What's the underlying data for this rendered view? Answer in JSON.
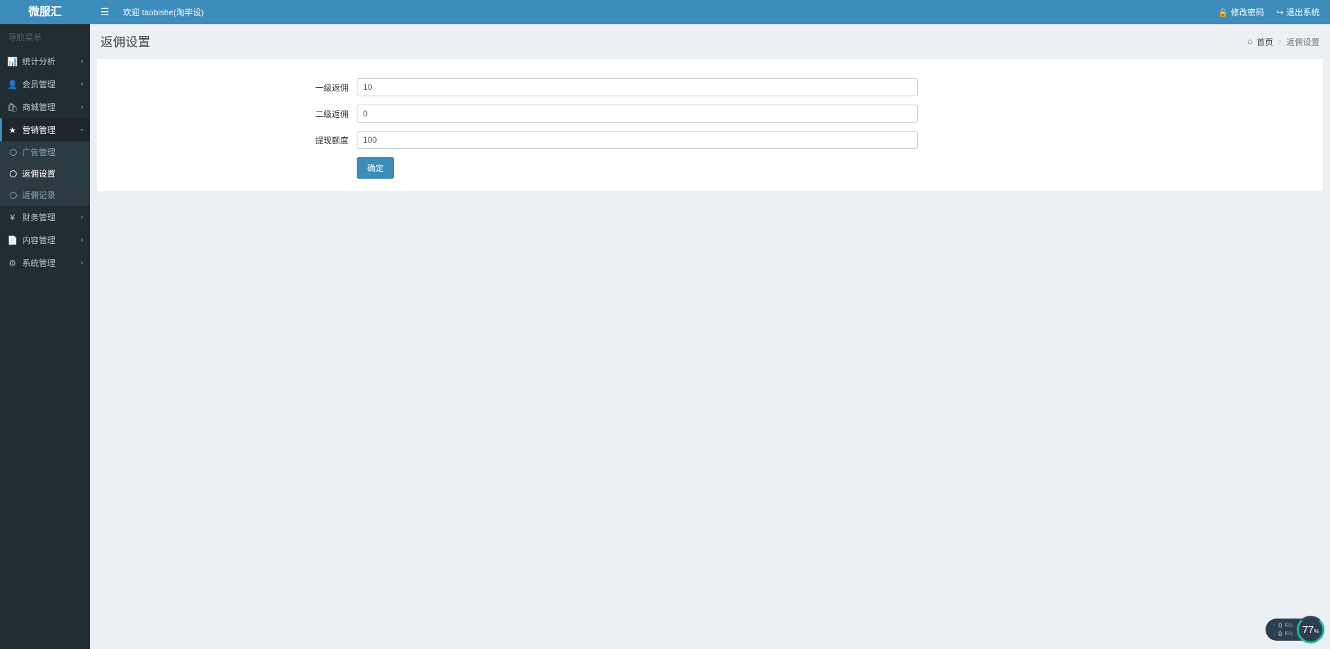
{
  "brand": "微服汇",
  "header": {
    "welcome": "欢迎 taobishe(淘毕设)",
    "change_password": "修改密码",
    "logout": "退出系统"
  },
  "sidebar": {
    "title": "导航菜单",
    "items": [
      {
        "icon": "📊",
        "label": "统计分析",
        "expanded": false
      },
      {
        "icon": "👤",
        "label": "会员管理",
        "expanded": false
      },
      {
        "icon": "🛍",
        "label": "商城管理",
        "expanded": false
      },
      {
        "icon": "★",
        "label": "营销管理",
        "expanded": true,
        "children": [
          {
            "label": "广告管理",
            "active": false
          },
          {
            "label": "返佣设置",
            "active": true
          },
          {
            "label": "返佣记录",
            "active": false
          }
        ]
      },
      {
        "icon": "¥",
        "label": "财务管理",
        "expanded": false
      },
      {
        "icon": "📄",
        "label": "内容管理",
        "expanded": false
      },
      {
        "icon": "⚙",
        "label": "系统管理",
        "expanded": false
      }
    ]
  },
  "page": {
    "title": "返佣设置",
    "breadcrumb": {
      "home": "首页",
      "current": "返佣设置"
    }
  },
  "form": {
    "level1": {
      "label": "一级返佣",
      "value": "10"
    },
    "level2": {
      "label": "二级返佣",
      "value": "0"
    },
    "withdraw": {
      "label": "提现额度",
      "value": "100"
    },
    "submit": "确定"
  },
  "netmon": {
    "up": "0",
    "down": "0",
    "unit": "K/s",
    "percent": "77"
  }
}
